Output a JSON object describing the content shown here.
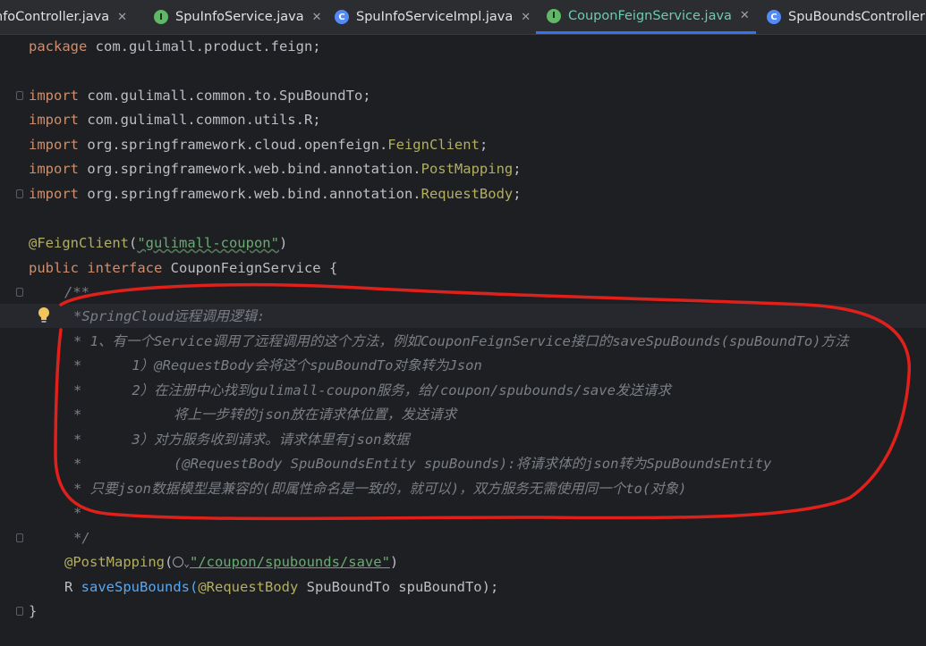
{
  "tabs": [
    {
      "label": "nfoController.java",
      "icon": "class",
      "active": false
    },
    {
      "label": "SpuInfoService.java",
      "icon": "interface",
      "active": false
    },
    {
      "label": "SpuInfoServiceImpl.java",
      "icon": "class",
      "active": false
    },
    {
      "label": "CouponFeignService.java",
      "icon": "interface",
      "active": true
    },
    {
      "label": "SpuBoundsController",
      "icon": "class",
      "active": false
    }
  ],
  "code": {
    "package": {
      "kw": "package",
      "name": " com.gulimall.product.feign;"
    },
    "imports": [
      {
        "kw": "import",
        "name": " com.gulimall.common.to.SpuBoundTo;",
        "hl": ""
      },
      {
        "kw": "import",
        "name": " com.gulimall.common.utils.R;",
        "hl": ""
      },
      {
        "kw": "import",
        "name": " org.springframework.cloud.openfeign.",
        "hl": "FeignClient",
        "tail": ";"
      },
      {
        "kw": "import",
        "name": " org.springframework.web.bind.annotation.",
        "hl": "PostMapping",
        "tail": ";"
      },
      {
        "kw": "import",
        "name": " org.springframework.web.bind.annotation.",
        "hl": "RequestBody",
        "tail": ";"
      }
    ],
    "annotation": {
      "name": "@FeignClient",
      "open": "(",
      "value": "\"gulimall-coupon\"",
      "close": ")"
    },
    "decl": {
      "kw1": "public",
      "kw2": " interface",
      "name": " CouponFeignService {"
    },
    "comment_open": "/**",
    "comment_lines": [
      "*SpringCloud远程调用逻辑:",
      "* 1、有一个Service调用了远程调用的这个方法，例如CouponFeignService接口的saveSpuBounds(spuBoundTo)方法",
      "*      1）@RequestBody会将这个spuBoundTo对象转为Json",
      "*      2）在注册中心找到gulimall-coupon服务，给/coupon/spubounds/save发送请求",
      "*           将上一步转的json放在请求体位置，发送请求",
      "*      3）对方服务收到请求。请求体里有json数据",
      "*           (@RequestBody SpuBoundsEntity spuBounds):将请求体的json转为SpuBoundsEntity",
      "* 只要json数据模型是兼容的(即属性命名是一致的，就可以)，双方服务无需使用同一个to(对象)",
      "*",
      "*/"
    ],
    "mapping": {
      "name": "@PostMapping",
      "open": "(",
      "value": "\"/coupon/spubounds/save\"",
      "close": ")"
    },
    "method": {
      "ret": "R",
      "name": " saveSpuBounds(",
      "ann": "@RequestBody",
      "rest": " SpuBoundTo spuBoundTo);"
    },
    "close_brace": "}"
  },
  "colors": {
    "background": "#1e1f22",
    "keyword": "#cf8e6d",
    "annotation": "#b3ae60",
    "string": "#6aab73",
    "comment": "#7a7e85",
    "highlight_circle": "#e0201b",
    "active_tab": "#6fc9b0"
  },
  "icons": {
    "hint": "lightbulb-icon",
    "url": "globe-icon"
  }
}
